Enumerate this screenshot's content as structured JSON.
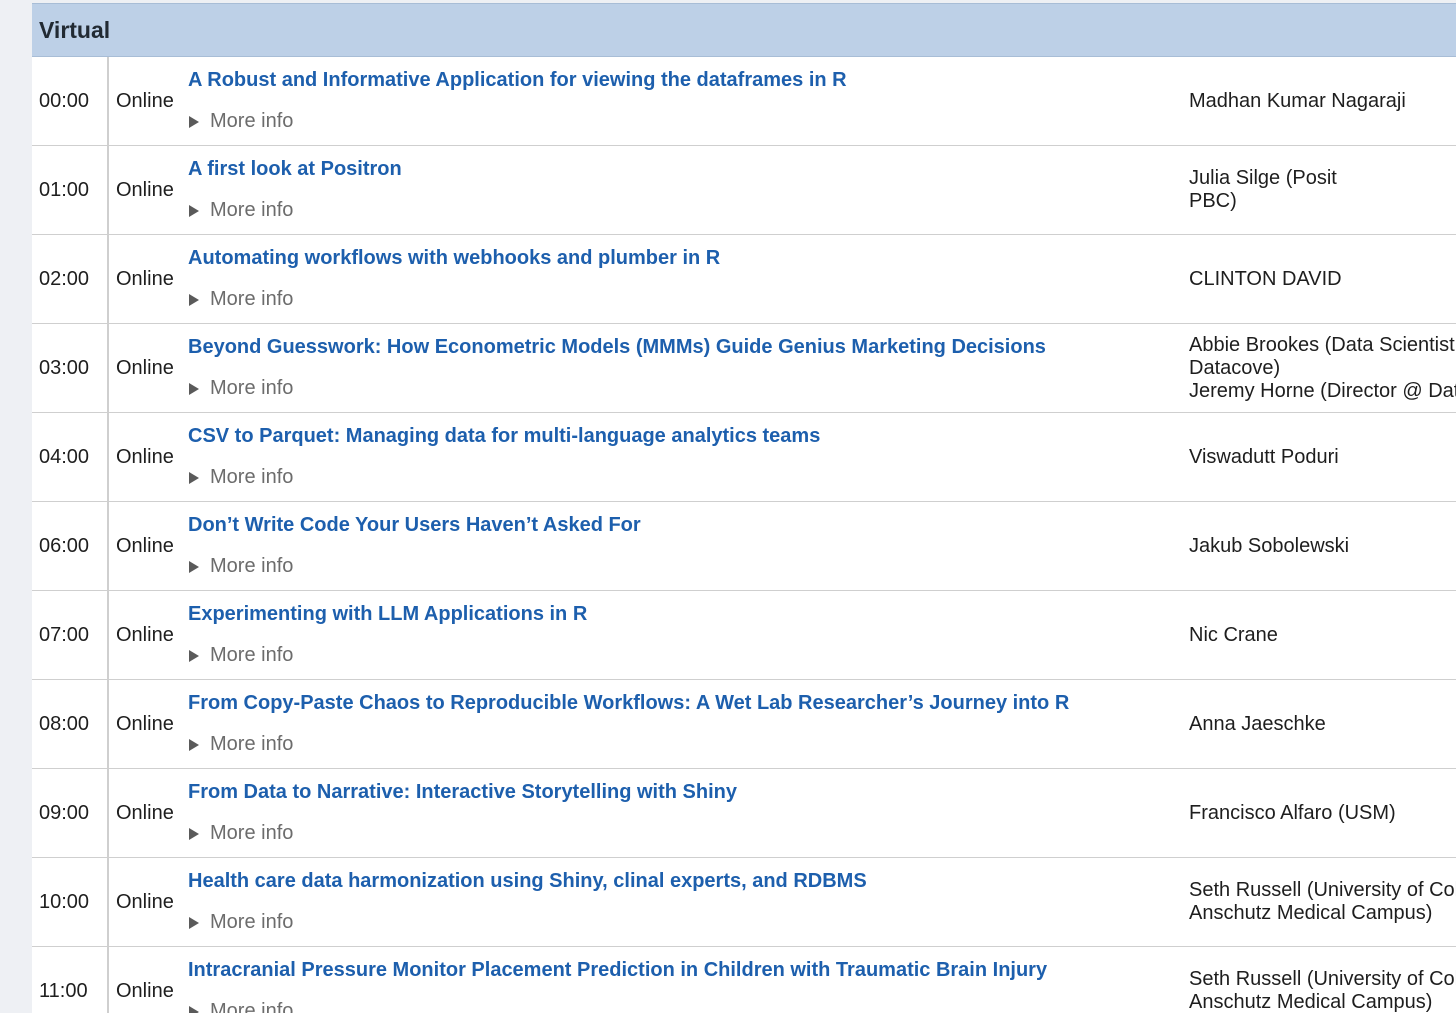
{
  "section": {
    "title": "Virtual"
  },
  "rows": [
    {
      "time": "00:00",
      "mode": "Online",
      "title": "A Robust and Informative Application for viewing the dataframes in R",
      "more": "More info",
      "speakers": [
        "Madhan Kumar Nagaraji"
      ]
    },
    {
      "time": "01:00",
      "mode": "Online",
      "title": "A first look at Positron",
      "more": "More info",
      "speakers": [
        "Julia Silge (Posit",
        "PBC)"
      ]
    },
    {
      "time": "02:00",
      "mode": "Online",
      "title": "Automating workflows with webhooks and plumber in R",
      "more": "More info",
      "speakers": [
        "CLINTON DAVID"
      ]
    },
    {
      "time": "03:00",
      "mode": "Online",
      "title": "Beyond Guesswork: How Econometric Models (MMMs) Guide Genius Marketing Decisions",
      "more": "More info",
      "speakers": [
        "Abbie Brookes (Data Scientist",
        "Datacove)",
        "Jeremy Horne (Director @ Data"
      ]
    },
    {
      "time": "04:00",
      "mode": "Online",
      "title": "CSV to Parquet: Managing data for multi-language analytics teams",
      "more": "More info",
      "speakers": [
        "Viswadutt Poduri"
      ]
    },
    {
      "time": "06:00",
      "mode": "Online",
      "title": "Don’t Write Code Your Users Haven’t Asked For",
      "more": "More info",
      "speakers": [
        "Jakub Sobolewski"
      ]
    },
    {
      "time": "07:00",
      "mode": "Online",
      "title": "Experimenting with LLM Applications in R",
      "more": "More info",
      "speakers": [
        "Nic Crane"
      ]
    },
    {
      "time": "08:00",
      "mode": "Online",
      "title": "From Copy-Paste Chaos to Reproducible Workflows: A Wet Lab Researcher’s Journey into R",
      "more": "More info",
      "speakers": [
        "Anna Jaeschke"
      ]
    },
    {
      "time": "09:00",
      "mode": "Online",
      "title": "From Data to Narrative: Interactive Storytelling with Shiny",
      "more": "More info",
      "speakers": [
        "Francisco Alfaro (USM)"
      ]
    },
    {
      "time": "10:00",
      "mode": "Online",
      "title": "Health care data harmonization using Shiny, clinal experts, and RDBMS",
      "more": "More info",
      "speakers": [
        "Seth Russell (University of Colo",
        "Anschutz Medical Campus)"
      ]
    },
    {
      "time": "11:00",
      "mode": "Online",
      "title": "Intracranial Pressure Monitor Placement Prediction in Children with Traumatic Brain Injury",
      "more": "More info",
      "speakers": [
        "Seth Russell (University of Colo",
        "Anschutz Medical Campus)"
      ]
    }
  ],
  "colors": {
    "header_bg": "#bdd0e7",
    "link": "#1d5fad",
    "muted": "#6c6c6c"
  }
}
